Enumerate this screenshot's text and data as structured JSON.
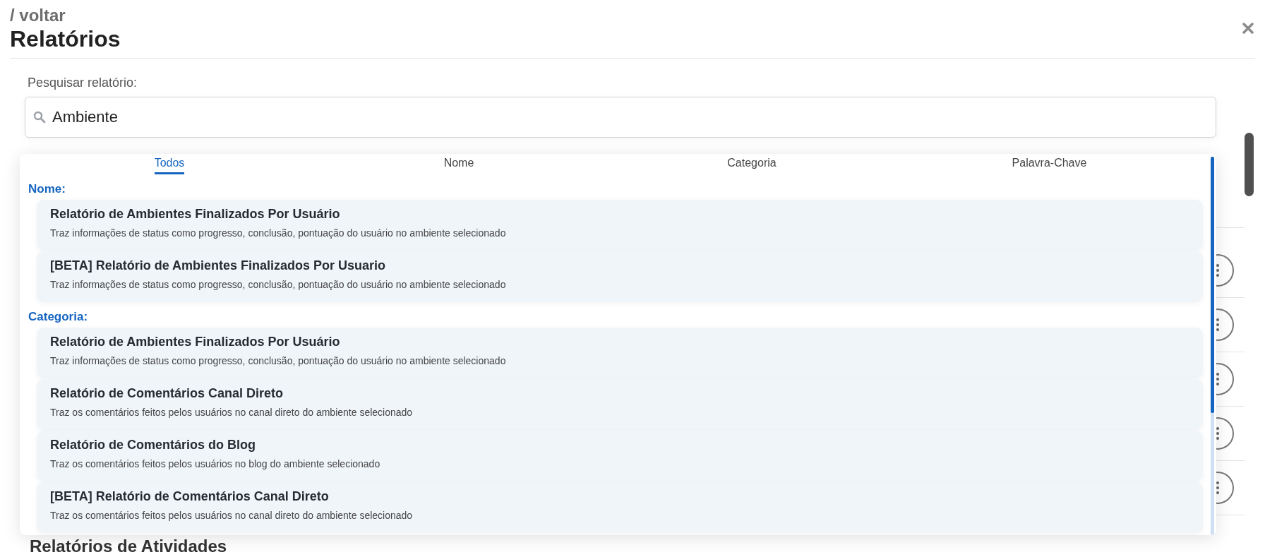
{
  "breadcrumb": "/ voltar",
  "title": "Relatórios",
  "search": {
    "label": "Pesquisar relatório:",
    "value": "Ambiente"
  },
  "tabs": [
    {
      "label": "Todos",
      "selected": true
    },
    {
      "label": "Nome",
      "selected": false
    },
    {
      "label": "Categoria",
      "selected": false
    },
    {
      "label": "Palavra-Chave",
      "selected": false
    }
  ],
  "groups": [
    {
      "label": "Nome:",
      "results": [
        {
          "title": "Relatório de Ambientes Finalizados Por Usuário",
          "description": "Traz informações de status como progresso, conclusão, pontuação do usuário no ambiente selecionado"
        },
        {
          "title": "[BETA] Relatório de Ambientes Finalizados Por Usuario",
          "description": "Traz informações de status como progresso, conclusão, pontuação do usuário no ambiente selecionado"
        }
      ]
    },
    {
      "label": "Categoria:",
      "results": [
        {
          "title": "Relatório de Ambientes Finalizados Por Usuário",
          "description": "Traz informações de status como progresso, conclusão, pontuação do usuário no ambiente selecionado"
        },
        {
          "title": "Relatório de Comentários Canal Direto",
          "description": "Traz os comentários feitos pelos usuários no canal direto do ambiente selecionado"
        },
        {
          "title": "Relatório de Comentários do Blog",
          "description": "Traz os comentários feitos pelos usuários no blog do ambiente selecionado"
        },
        {
          "title": "[BETA] Relatório de Comentários Canal Direto",
          "description": "Traz os comentários feitos pelos usuários no canal direto do ambiente selecionado"
        }
      ]
    }
  ],
  "background_rows": [
    {
      "kind": "menu"
    },
    {
      "kind": "menu"
    },
    {
      "kind": "menu"
    },
    {
      "kind": "menu"
    },
    {
      "kind": "menu"
    }
  ],
  "section_heading": "Relatórios de Atividades"
}
